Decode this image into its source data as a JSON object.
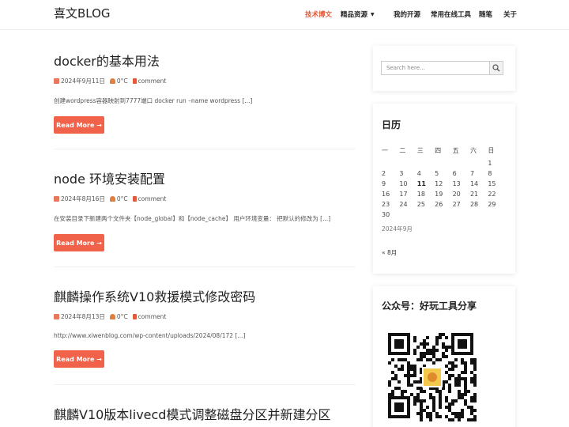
{
  "header": {
    "brand": "喜文BLOG",
    "nav": [
      "技术博文",
      "精品资源",
      "我的开源",
      "常用在线工具",
      "随笔",
      "关于"
    ],
    "active_nav": "技术博文",
    "accent_color": "#e05a3b"
  },
  "posts": [
    {
      "title": "docker的基本用法",
      "date": "2024年9月11日",
      "temp": "0°C",
      "comment": "comment",
      "excerpt": "创建wordpress容器映射到7777端口 docker run –name wordpress [...]",
      "button": "Read More →"
    },
    {
      "title": "node 环境安装配置",
      "date": "2024年8月16日",
      "temp": "0°C",
      "comment": "comment",
      "excerpt": "在安装目录下新建两个文件夹【node_global】和【node_cache】 用户环境变量： 把默认的修改为 [...]",
      "button": "Read More →"
    },
    {
      "title": "麒麟操作系统V10救援模式修改密码",
      "date": "2024年8月13日",
      "temp": "0°C",
      "comment": "comment",
      "excerpt": "http://www.xiwenblog.com/wp-content/uploads/2024/08/172 [...]",
      "button": "Read More →"
    },
    {
      "title": "麒麟V10版本livecd模式调整磁盘分区并新建分区"
    }
  ],
  "sidebar": {
    "search_placeholder": "Search here...",
    "calendar": {
      "title": "日历",
      "weekdays": [
        "一",
        "二",
        "三",
        "四",
        "五",
        "六",
        "日"
      ],
      "weeks": [
        [
          "",
          "",
          "",
          "",
          "",
          "",
          "1"
        ],
        [
          "2",
          "3",
          "4",
          "5",
          "6",
          "7",
          "8"
        ],
        [
          "9",
          "10",
          "11",
          "12",
          "13",
          "14",
          "15"
        ],
        [
          "16",
          "17",
          "18",
          "19",
          "20",
          "21",
          "22"
        ],
        [
          "23",
          "24",
          "25",
          "26",
          "27",
          "28",
          "29"
        ],
        [
          "30",
          "",
          "",
          "",
          "",
          "",
          ""
        ]
      ],
      "today": "11",
      "caption": "2024年9月",
      "prev": "« 8月"
    },
    "wechat_title": "公众号：好玩工具分享"
  }
}
